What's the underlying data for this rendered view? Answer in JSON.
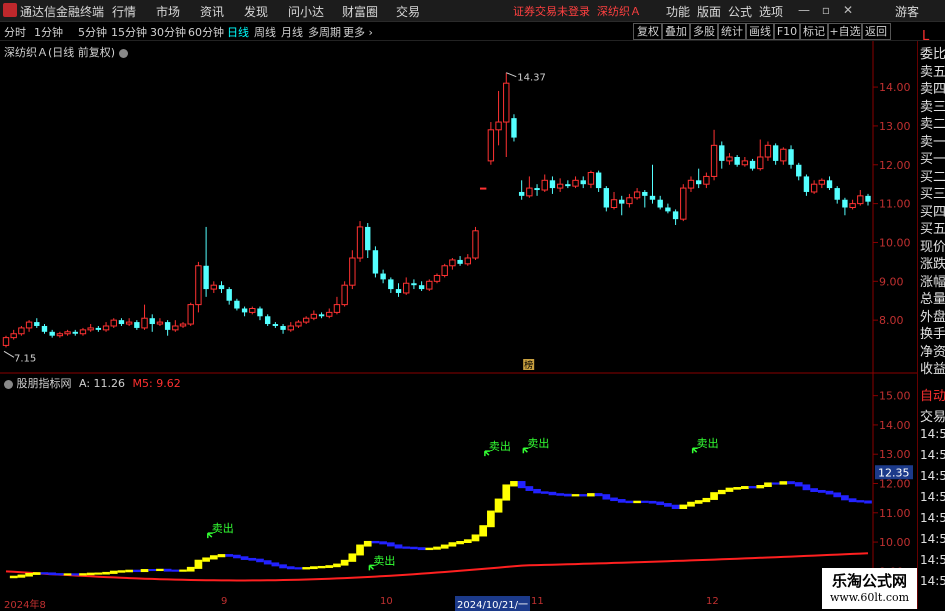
{
  "app": {
    "title": "通达信金融终端",
    "menu": [
      "行情",
      "市场",
      "资讯",
      "发现",
      "问小达",
      "财富圈",
      "交易"
    ],
    "login_status": "证券交易未登录",
    "stock_name_top": "深纺织Ａ",
    "right_menu": [
      "功能",
      "版面",
      "公式",
      "选项"
    ],
    "guest": "游客",
    "window_buttons": [
      "—",
      "▫",
      "✕"
    ]
  },
  "periods": {
    "items": [
      "分时",
      "1分钟",
      "5分钟",
      "15分钟",
      "30分钟",
      "60分钟",
      "日线",
      "周线",
      "月线",
      "多周期",
      "更多"
    ],
    "active": "日线"
  },
  "toolbar": [
    "复权",
    "叠加",
    "多股",
    "统计",
    "画线",
    "F10",
    "标记",
    "+自选",
    "返回"
  ],
  "main_chart": {
    "title": "深纺织Ａ(日线 前复权)",
    "price_axis": [
      "14.00",
      "13.00",
      "12.00",
      "11.00",
      "10.00",
      "9.00",
      "8.00"
    ],
    "high_label": "14.37",
    "low_label": "7.15",
    "mark_label": "榜"
  },
  "indicator": {
    "name": "股朋指标网",
    "a_label": "A: 11.26",
    "m5_label": "M5: 9.62",
    "axis": [
      "15.00",
      "14.00",
      "13.00",
      "12.00",
      "11.00",
      "10.00",
      "9.00"
    ],
    "current_value": "12.35",
    "signal_text": "卖出",
    "colors": {
      "up": "#ffff00",
      "down": "#2222ff",
      "ma": "#ff2020"
    }
  },
  "x_axis": {
    "labels": [
      "2024年8",
      "9",
      "10",
      "2024/10/21/一",
      "11",
      "12"
    ]
  },
  "right_panel": {
    "items": [
      "委比",
      "卖五",
      "卖四",
      "卖三",
      "卖二",
      "卖一",
      "买一",
      "买二",
      "买三",
      "买四",
      "买五",
      "现价",
      "涨跌",
      "涨幅",
      "总量",
      "外盘",
      "换手",
      "净资",
      "收益"
    ],
    "bottom_items": [
      "自动",
      "交易",
      "14:56",
      "14:56",
      "14:56",
      "14:56",
      "14:56",
      "14:56",
      "14:56",
      "14:56"
    ],
    "bottom_prefix": "L"
  },
  "watermark": {
    "main": "乐淘公式网",
    "url": "www.60lt.com"
  },
  "chart_data": {
    "type": "candlestick",
    "title": "深纺织Ａ(日线 前复权)",
    "price_range": [
      7.0,
      14.8
    ],
    "candles": [
      [
        7.35,
        7.55,
        7.3,
        7.6
      ],
      [
        7.55,
        7.65,
        7.5,
        7.75
      ],
      [
        7.65,
        7.8,
        7.6,
        7.85
      ],
      [
        7.8,
        7.95,
        7.7,
        8.0
      ],
      [
        7.95,
        7.85,
        7.8,
        8.05
      ],
      [
        7.85,
        7.7,
        7.65,
        7.9
      ],
      [
        7.7,
        7.6,
        7.55,
        7.75
      ],
      [
        7.6,
        7.65,
        7.55,
        7.7
      ],
      [
        7.65,
        7.7,
        7.6,
        7.75
      ],
      [
        7.7,
        7.65,
        7.6,
        7.75
      ],
      [
        7.65,
        7.75,
        7.6,
        7.8
      ],
      [
        7.75,
        7.8,
        7.7,
        7.9
      ],
      [
        7.8,
        7.75,
        7.7,
        7.85
      ],
      [
        7.75,
        7.85,
        7.7,
        7.95
      ],
      [
        7.85,
        8.0,
        7.8,
        8.05
      ],
      [
        8.0,
        7.9,
        7.85,
        8.05
      ],
      [
        7.9,
        7.95,
        7.85,
        8.05
      ],
      [
        7.95,
        7.8,
        7.75,
        8.0
      ],
      [
        7.8,
        8.05,
        7.75,
        8.4
      ],
      [
        8.05,
        7.9,
        7.7,
        8.15
      ],
      [
        7.9,
        7.95,
        7.85,
        8.05
      ],
      [
        7.95,
        7.75,
        7.6,
        8.0
      ],
      [
        7.75,
        7.85,
        7.7,
        8.0
      ],
      [
        7.85,
        7.9,
        7.8,
        7.95
      ],
      [
        7.9,
        8.4,
        7.85,
        8.45
      ],
      [
        8.4,
        9.4,
        8.2,
        9.5
      ],
      [
        9.4,
        8.8,
        8.6,
        10.4
      ],
      [
        8.8,
        8.9,
        8.7,
        9.0
      ],
      [
        8.9,
        8.8,
        8.7,
        9.0
      ],
      [
        8.8,
        8.5,
        8.4,
        8.85
      ],
      [
        8.5,
        8.3,
        8.25,
        8.55
      ],
      [
        8.3,
        8.2,
        8.1,
        8.35
      ],
      [
        8.2,
        8.3,
        8.15,
        8.35
      ],
      [
        8.3,
        8.1,
        8.0,
        8.35
      ],
      [
        8.1,
        7.9,
        7.85,
        8.15
      ],
      [
        7.9,
        7.85,
        7.8,
        7.95
      ],
      [
        7.85,
        7.75,
        7.65,
        7.9
      ],
      [
        7.75,
        7.85,
        7.7,
        7.95
      ],
      [
        7.85,
        7.95,
        7.8,
        8.0
      ],
      [
        7.95,
        8.05,
        7.9,
        8.1
      ],
      [
        8.05,
        8.15,
        8.0,
        8.25
      ],
      [
        8.15,
        8.1,
        8.05,
        8.2
      ],
      [
        8.1,
        8.2,
        8.05,
        8.3
      ],
      [
        8.2,
        8.4,
        8.15,
        8.6
      ],
      [
        8.4,
        8.9,
        8.35,
        9.0
      ],
      [
        8.9,
        9.6,
        8.8,
        9.8
      ],
      [
        9.6,
        10.4,
        9.5,
        10.55
      ],
      [
        10.4,
        9.8,
        9.6,
        10.5
      ],
      [
        9.8,
        9.2,
        9.1,
        9.9
      ],
      [
        9.2,
        9.05,
        8.95,
        9.3
      ],
      [
        9.05,
        8.8,
        8.7,
        9.1
      ],
      [
        8.8,
        8.7,
        8.6,
        8.95
      ],
      [
        8.7,
        8.95,
        8.65,
        9.1
      ],
      [
        8.95,
        8.9,
        8.8,
        9.05
      ],
      [
        8.9,
        8.8,
        8.75,
        9.0
      ],
      [
        8.8,
        9.0,
        8.75,
        9.05
      ],
      [
        9.0,
        9.15,
        8.95,
        9.2
      ],
      [
        9.15,
        9.4,
        9.1,
        9.45
      ],
      [
        9.4,
        9.55,
        9.3,
        9.6
      ],
      [
        9.55,
        9.45,
        9.4,
        9.65
      ],
      [
        9.45,
        9.6,
        9.4,
        9.7
      ],
      [
        9.6,
        10.3,
        9.55,
        10.4
      ],
      [
        11.4,
        11.4,
        11.4,
        11.4
      ],
      [
        12.1,
        12.9,
        12.0,
        13.1
      ],
      [
        12.9,
        13.1,
        12.5,
        13.9
      ],
      [
        13.1,
        14.1,
        12.2,
        14.37
      ],
      [
        13.2,
        12.7,
        12.6,
        13.3
      ],
      [
        11.3,
        11.2,
        11.1,
        11.6
      ],
      [
        11.2,
        11.4,
        11.15,
        11.7
      ],
      [
        11.4,
        11.35,
        11.2,
        11.5
      ],
      [
        11.35,
        11.6,
        11.3,
        11.75
      ],
      [
        11.6,
        11.4,
        11.25,
        11.7
      ],
      [
        11.4,
        11.5,
        11.3,
        11.65
      ],
      [
        11.5,
        11.45,
        11.4,
        11.6
      ],
      [
        11.45,
        11.6,
        11.4,
        11.7
      ],
      [
        11.6,
        11.5,
        11.4,
        11.7
      ],
      [
        11.5,
        11.8,
        11.4,
        11.85
      ],
      [
        11.8,
        11.4,
        11.3,
        11.85
      ],
      [
        11.4,
        10.9,
        10.8,
        11.45
      ],
      [
        10.9,
        11.1,
        10.85,
        11.3
      ],
      [
        11.1,
        11.0,
        10.7,
        11.2
      ],
      [
        11.0,
        11.15,
        10.9,
        11.25
      ],
      [
        11.15,
        11.3,
        11.1,
        11.4
      ],
      [
        11.3,
        11.2,
        10.9,
        11.35
      ],
      [
        11.2,
        11.1,
        11.0,
        12.0
      ],
      [
        11.1,
        10.9,
        10.85,
        11.2
      ],
      [
        10.9,
        10.8,
        10.75,
        11.0
      ],
      [
        10.8,
        10.6,
        10.45,
        10.85
      ],
      [
        10.6,
        11.4,
        10.55,
        11.5
      ],
      [
        11.4,
        11.6,
        11.3,
        11.7
      ],
      [
        11.6,
        11.5,
        11.4,
        11.9
      ],
      [
        11.5,
        11.7,
        11.4,
        11.8
      ],
      [
        11.7,
        12.5,
        11.6,
        12.9
      ],
      [
        12.5,
        12.1,
        11.9,
        12.6
      ],
      [
        12.1,
        12.2,
        12.0,
        12.3
      ],
      [
        12.2,
        12.0,
        11.95,
        12.25
      ],
      [
        12.0,
        12.1,
        11.95,
        12.2
      ],
      [
        12.1,
        11.9,
        11.85,
        12.15
      ],
      [
        11.9,
        12.2,
        11.85,
        12.65
      ],
      [
        12.2,
        12.5,
        12.1,
        12.6
      ],
      [
        12.5,
        12.1,
        12.0,
        12.55
      ],
      [
        12.1,
        12.4,
        12.0,
        12.45
      ],
      [
        12.4,
        12.0,
        11.9,
        12.5
      ],
      [
        12.0,
        11.7,
        11.6,
        12.05
      ],
      [
        11.7,
        11.3,
        11.2,
        11.75
      ],
      [
        11.3,
        11.5,
        11.25,
        11.6
      ],
      [
        11.5,
        11.6,
        11.4,
        11.65
      ],
      [
        11.6,
        11.4,
        11.35,
        11.7
      ],
      [
        11.4,
        11.1,
        11.0,
        11.45
      ],
      [
        11.1,
        10.9,
        10.7,
        11.15
      ],
      [
        10.9,
        11.0,
        10.85,
        11.1
      ],
      [
        11.0,
        11.2,
        10.95,
        11.35
      ],
      [
        11.2,
        11.05,
        10.95,
        11.25
      ]
    ],
    "indicator_range": [
      8.5,
      15.5
    ],
    "indicator_line_start": 8.8,
    "indicator_line_end": 12.05,
    "ma_start": 9.0,
    "ma_end": 9.62,
    "sell_signals": [
      {
        "index": 27,
        "value": 10.1
      },
      {
        "index": 48,
        "value": 9.0
      },
      {
        "index": 63,
        "value": 12.9
      },
      {
        "index": 68,
        "value": 13.0
      },
      {
        "index": 90,
        "value": 13.0
      }
    ]
  }
}
